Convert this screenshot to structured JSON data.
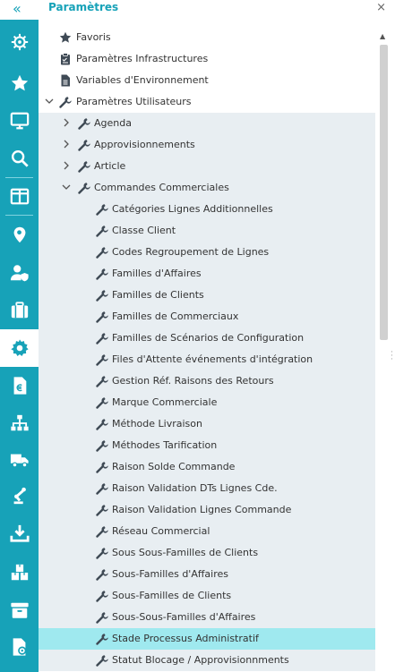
{
  "header": {
    "title": "Paramètres",
    "collapse_glyph": "«",
    "close_glyph": "×"
  },
  "rail": {
    "items": [
      {
        "icon": "helm-icon",
        "active": false
      },
      {
        "icon": "star-icon",
        "active": false
      },
      {
        "icon": "monitor-icon",
        "active": false
      },
      {
        "icon": "search-icon",
        "active": false
      },
      {
        "icon": "panels-icon",
        "active": false
      },
      {
        "icon": "map-search-icon",
        "active": false
      },
      {
        "icon": "user-shield-icon",
        "active": false
      },
      {
        "icon": "briefcase-icon",
        "active": false
      },
      {
        "icon": "gear-icon",
        "active": true
      },
      {
        "icon": "invoice-euro-icon",
        "active": false
      },
      {
        "icon": "org-chart-icon",
        "active": false
      },
      {
        "icon": "truck-icon",
        "active": false
      },
      {
        "icon": "robot-arm-icon",
        "active": false
      },
      {
        "icon": "download-tray-icon",
        "active": false
      },
      {
        "icon": "boxes-icon",
        "active": false
      },
      {
        "icon": "archive-icon",
        "active": false
      },
      {
        "icon": "document-gear-icon",
        "active": false
      }
    ]
  },
  "tree": {
    "rows": [
      {
        "label": "Favoris",
        "level": 0,
        "icon": "star",
        "caret": "",
        "shade": false
      },
      {
        "label": "Paramètres Infrastructures",
        "level": 0,
        "icon": "clipboard",
        "caret": "",
        "shade": false
      },
      {
        "label": "Variables d'Environnement",
        "level": 0,
        "icon": "doc",
        "caret": "",
        "shade": false
      },
      {
        "label": "Paramètres Utilisateurs",
        "level": 0,
        "icon": "wrench",
        "caret": "down",
        "shade": false
      },
      {
        "label": "Agenda",
        "level": 1,
        "icon": "wrench",
        "caret": "right",
        "shade": true
      },
      {
        "label": "Approvisionnements",
        "level": 1,
        "icon": "wrench",
        "caret": "right",
        "shade": true
      },
      {
        "label": "Article",
        "level": 1,
        "icon": "wrench",
        "caret": "right",
        "shade": true
      },
      {
        "label": "Commandes Commerciales",
        "level": 1,
        "icon": "wrench",
        "caret": "down",
        "shade": true
      },
      {
        "label": "Catégories Lignes Additionnelles",
        "level": 2,
        "icon": "wrench",
        "caret": "",
        "shade": true
      },
      {
        "label": "Classe Client",
        "level": 2,
        "icon": "wrench",
        "caret": "",
        "shade": true
      },
      {
        "label": "Codes Regroupement de Lignes",
        "level": 2,
        "icon": "wrench",
        "caret": "",
        "shade": true
      },
      {
        "label": "Familles d'Affaires",
        "level": 2,
        "icon": "wrench",
        "caret": "",
        "shade": true
      },
      {
        "label": "Familles de Clients",
        "level": 2,
        "icon": "wrench",
        "caret": "",
        "shade": true
      },
      {
        "label": "Familles de Commerciaux",
        "level": 2,
        "icon": "wrench",
        "caret": "",
        "shade": true
      },
      {
        "label": "Familles de Scénarios de Configuration",
        "level": 2,
        "icon": "wrench",
        "caret": "",
        "shade": true
      },
      {
        "label": "Files d'Attente événements d'intégration",
        "level": 2,
        "icon": "wrench",
        "caret": "",
        "shade": true
      },
      {
        "label": "Gestion Réf. Raisons des Retours",
        "level": 2,
        "icon": "wrench",
        "caret": "",
        "shade": true
      },
      {
        "label": "Marque Commerciale",
        "level": 2,
        "icon": "wrench",
        "caret": "",
        "shade": true
      },
      {
        "label": "Méthode Livraison",
        "level": 2,
        "icon": "wrench",
        "caret": "",
        "shade": true
      },
      {
        "label": "Méthodes Tarification",
        "level": 2,
        "icon": "wrench",
        "caret": "",
        "shade": true
      },
      {
        "label": "Raison Solde Commande",
        "level": 2,
        "icon": "wrench",
        "caret": "",
        "shade": true
      },
      {
        "label": "Raison Validation DTs Lignes Cde.",
        "level": 2,
        "icon": "wrench",
        "caret": "",
        "shade": true
      },
      {
        "label": "Raison Validation Lignes Commande",
        "level": 2,
        "icon": "wrench",
        "caret": "",
        "shade": true
      },
      {
        "label": "Réseau Commercial",
        "level": 2,
        "icon": "wrench",
        "caret": "",
        "shade": true
      },
      {
        "label": "Sous Sous-Familles de Clients",
        "level": 2,
        "icon": "wrench",
        "caret": "",
        "shade": true
      },
      {
        "label": "Sous-Familles d'Affaires",
        "level": 2,
        "icon": "wrench",
        "caret": "",
        "shade": true
      },
      {
        "label": "Sous-Familles de Clients",
        "level": 2,
        "icon": "wrench",
        "caret": "",
        "shade": true
      },
      {
        "label": "Sous-Sous-Familles d'Affaires",
        "level": 2,
        "icon": "wrench",
        "caret": "",
        "shade": true
      },
      {
        "label": "Stade Processus Administratif",
        "level": 2,
        "icon": "wrench",
        "caret": "",
        "shade": true,
        "selected": true
      },
      {
        "label": "Statut Blocage / Approvisionnments",
        "level": 2,
        "icon": "wrench",
        "caret": "",
        "shade": true
      }
    ]
  },
  "colors": {
    "accent": "#17a2b8",
    "selected": "#9fe9ef",
    "shade": "#e8eef2",
    "icon": "#3f4a55"
  }
}
